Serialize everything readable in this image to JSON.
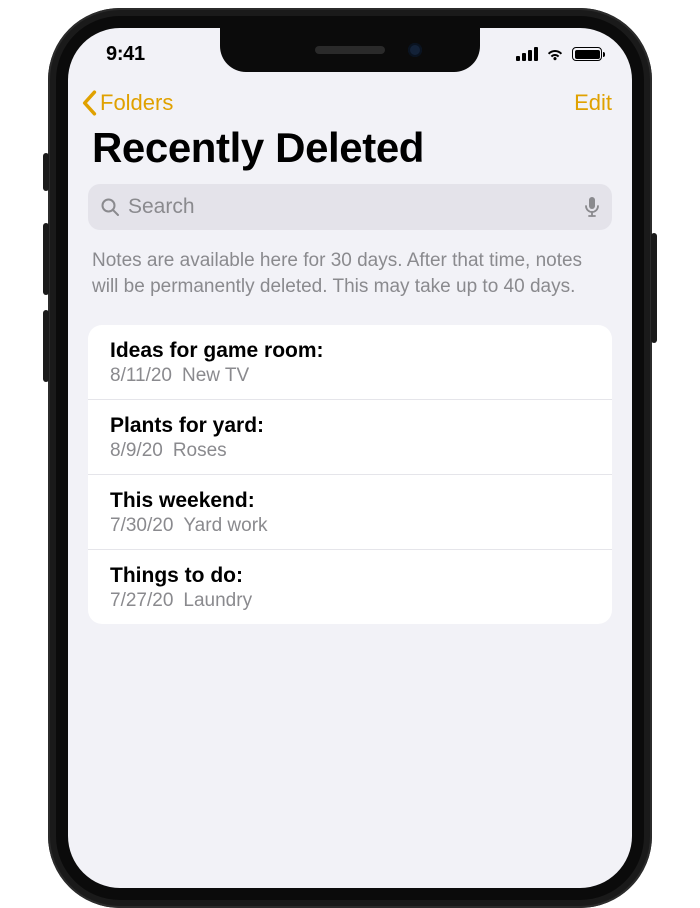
{
  "status": {
    "time": "9:41"
  },
  "nav": {
    "back_label": "Folders",
    "edit_label": "Edit"
  },
  "page": {
    "title": "Recently Deleted",
    "info": "Notes are available here for 30 days. After that time, notes will be permanently deleted. This may take up to 40 days."
  },
  "search": {
    "placeholder": "Search"
  },
  "notes": [
    {
      "title": "Ideas for game room:",
      "date": "8/11/20",
      "preview": "New TV"
    },
    {
      "title": "Plants for yard:",
      "date": "8/9/20",
      "preview": "Roses"
    },
    {
      "title": "This weekend:",
      "date": "7/30/20",
      "preview": "Yard work"
    },
    {
      "title": "Things to do:",
      "date": "7/27/20",
      "preview": "Laundry"
    }
  ]
}
